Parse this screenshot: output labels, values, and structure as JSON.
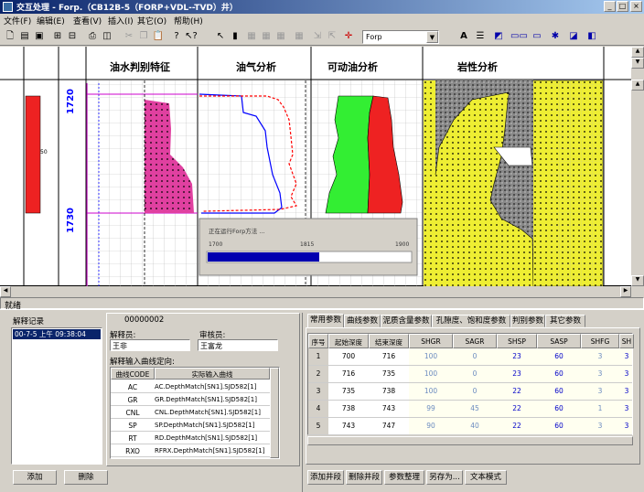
{
  "window": {
    "title": "交互处理 - Forp.（CB12B-5（FORP+VDL--TVD）井）",
    "minimize": "_",
    "maximize": "□",
    "close": "×"
  },
  "menu": [
    "文件(F)",
    "编辑(E)",
    "查看(V)",
    "插入(I)",
    "其它(O)",
    "帮助(H)"
  ],
  "toolbar": {
    "combo_value": "Forp",
    "icons": [
      "new-file-icon",
      "open-folder-icon",
      "save-icon",
      "import-icon",
      "export-icon",
      "print-icon",
      "print-preview-icon",
      "cut-icon",
      "copy-icon",
      "paste-icon",
      "help-icon",
      "context-help-icon",
      "pointer-icon",
      "select-icon",
      "grid-a-icon",
      "grid-b-icon",
      "grid-c-icon",
      "arrange-a-icon",
      "arrange-b-icon",
      "crosshair-icon",
      "font-icon",
      "format-icon",
      "tool-a-icon",
      "tool-b-icon",
      "tool-c-icon",
      "tool-d-icon",
      "tool-e-icon"
    ]
  },
  "log": {
    "tracks": [
      "油水判别特征",
      "油气分析",
      "可动油分析",
      "岩性分析"
    ],
    "depths": [
      "1720",
      "1730"
    ],
    "zone_number": "50",
    "dialog": {
      "title": "正在运行Forp方法 ...",
      "start": "1700",
      "current": "1815",
      "end": "1900",
      "progress": 0.55
    }
  },
  "status": "就绪",
  "records": {
    "title": "解释记录",
    "items": [
      "00-7-5 上午 09:38:04"
    ],
    "add": "添加",
    "delete": "删除"
  },
  "detail": {
    "id": "00000002",
    "interpreter_label": "解释员:",
    "interpreter": "王非",
    "reviewer_label": "审核员:",
    "reviewer": "王富龙",
    "curve_label": "解释输入曲线定向:",
    "headers": [
      "曲线CODE",
      "实际输入曲线"
    ],
    "rows": [
      [
        "AC",
        "AC.DepthMatch[SN1].SJD582[1]"
      ],
      [
        "GR",
        "GR.DepthMatch[SN1].SJD582[1]"
      ],
      [
        "CNL",
        "CNL.DepthMatch[SN1].SJD582[1]"
      ],
      [
        "SP",
        "SP.DepthMatch[SN1].SJD582[1]"
      ],
      [
        "RT",
        "RD.DepthMatch[SN1].SJD582[1]"
      ],
      [
        "RXO",
        "RFRX.DepthMatch[SN1].SJD582[1]"
      ]
    ]
  },
  "params": {
    "tabs": [
      "常用参数",
      "曲线参数",
      "泥质含量参数",
      "孔隙度、饱和度参数",
      "判别参数",
      "其它参数"
    ],
    "headers": [
      "序号",
      "起始深度",
      "结束深度",
      "SHGR",
      "SAGR",
      "SHSP",
      "SASP",
      "SHFG",
      "SH"
    ],
    "rows": [
      [
        "1",
        "700",
        "716",
        "100",
        "0",
        "23",
        "60",
        "3",
        "3"
      ],
      [
        "2",
        "716",
        "735",
        "100",
        "0",
        "23",
        "60",
        "3",
        "3"
      ],
      [
        "3",
        "735",
        "738",
        "100",
        "0",
        "22",
        "60",
        "3",
        "3"
      ],
      [
        "4",
        "738",
        "743",
        "99",
        "45",
        "22",
        "60",
        "1",
        "3"
      ],
      [
        "5",
        "743",
        "747",
        "90",
        "40",
        "22",
        "60",
        "3",
        "3"
      ]
    ],
    "buttons": [
      "添加井段",
      "删除井段",
      "参数整理",
      "另存为...",
      "文本模式"
    ]
  },
  "colors": {
    "magenta_fill": "#e040a0",
    "green_fill": "#33ee33",
    "red_fill": "#ee2222",
    "yellow_fill": "#eeee33",
    "titlebar": "#0a246a"
  }
}
